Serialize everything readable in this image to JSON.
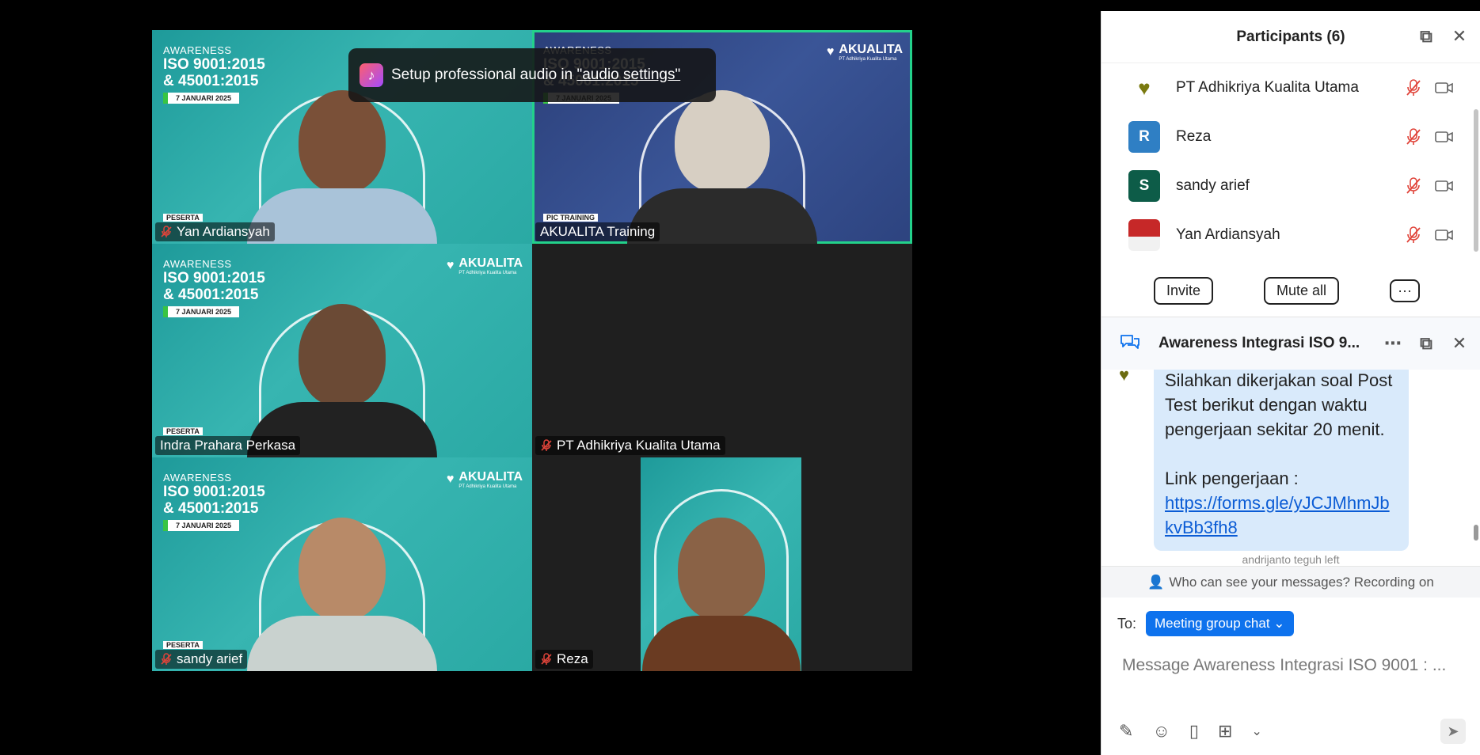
{
  "toast": {
    "text": "Setup professional audio in ",
    "link": "\"audio settings\""
  },
  "slide": {
    "awareness": "AWARENESS",
    "iso_line1": "ISO 9001:2015",
    "iso_line2": "& 45001:2015",
    "date": "7 JANUARI 2025",
    "brand": "AKUALITA",
    "brand_sub": "PT Adhikriya Kualita Utama",
    "role_participant": "PESERTA",
    "role_pic": "PIC TRAINING"
  },
  "tiles": [
    {
      "name": "Yan Ardiansyah",
      "muted": true
    },
    {
      "name": "AKUALITA Training",
      "muted": false
    },
    {
      "name": "Indra Prahara Perkasa",
      "muted": false
    },
    {
      "name": "PT Adhikriya Kualita Utama",
      "muted": true
    },
    {
      "name": "sandy arief",
      "muted": true
    },
    {
      "name": "Reza",
      "muted": true
    }
  ],
  "participants": {
    "title": "Participants (6)",
    "items": [
      {
        "name": "PT Adhikriya Kualita Utama",
        "initial": "",
        "color": "#ffffff"
      },
      {
        "name": "Reza",
        "initial": "R",
        "color": "#2f7fc4"
      },
      {
        "name": "sandy arief",
        "initial": "S",
        "color": "#0d5c48"
      },
      {
        "name": "Yan Ardiansyah",
        "initial": "",
        "color": "#c62828"
      }
    ],
    "invite": "Invite",
    "mute_all": "Mute all",
    "more": "···"
  },
  "chat": {
    "title": "Awareness Integrasi ISO 9...",
    "message_lines": [
      "Silahkan dikerjakan soal Post Test berikut dengan waktu pengerjaan sekitar 20 menit.",
      "Link pengerjaan :"
    ],
    "link": "https://forms.gle/yJCJMhmJbkvBb3fh8",
    "left_note": "andrijanto teguh left",
    "privacy": "Who can see your messages? Recording on",
    "to_label": "To:",
    "recipient": "Meeting group chat",
    "placeholder": "Message Awareness Integrasi ISO 9001 : ..."
  },
  "colors": {
    "speaking": "#23d18b",
    "accent": "#0e72ed",
    "muted_red": "#e0443a"
  }
}
